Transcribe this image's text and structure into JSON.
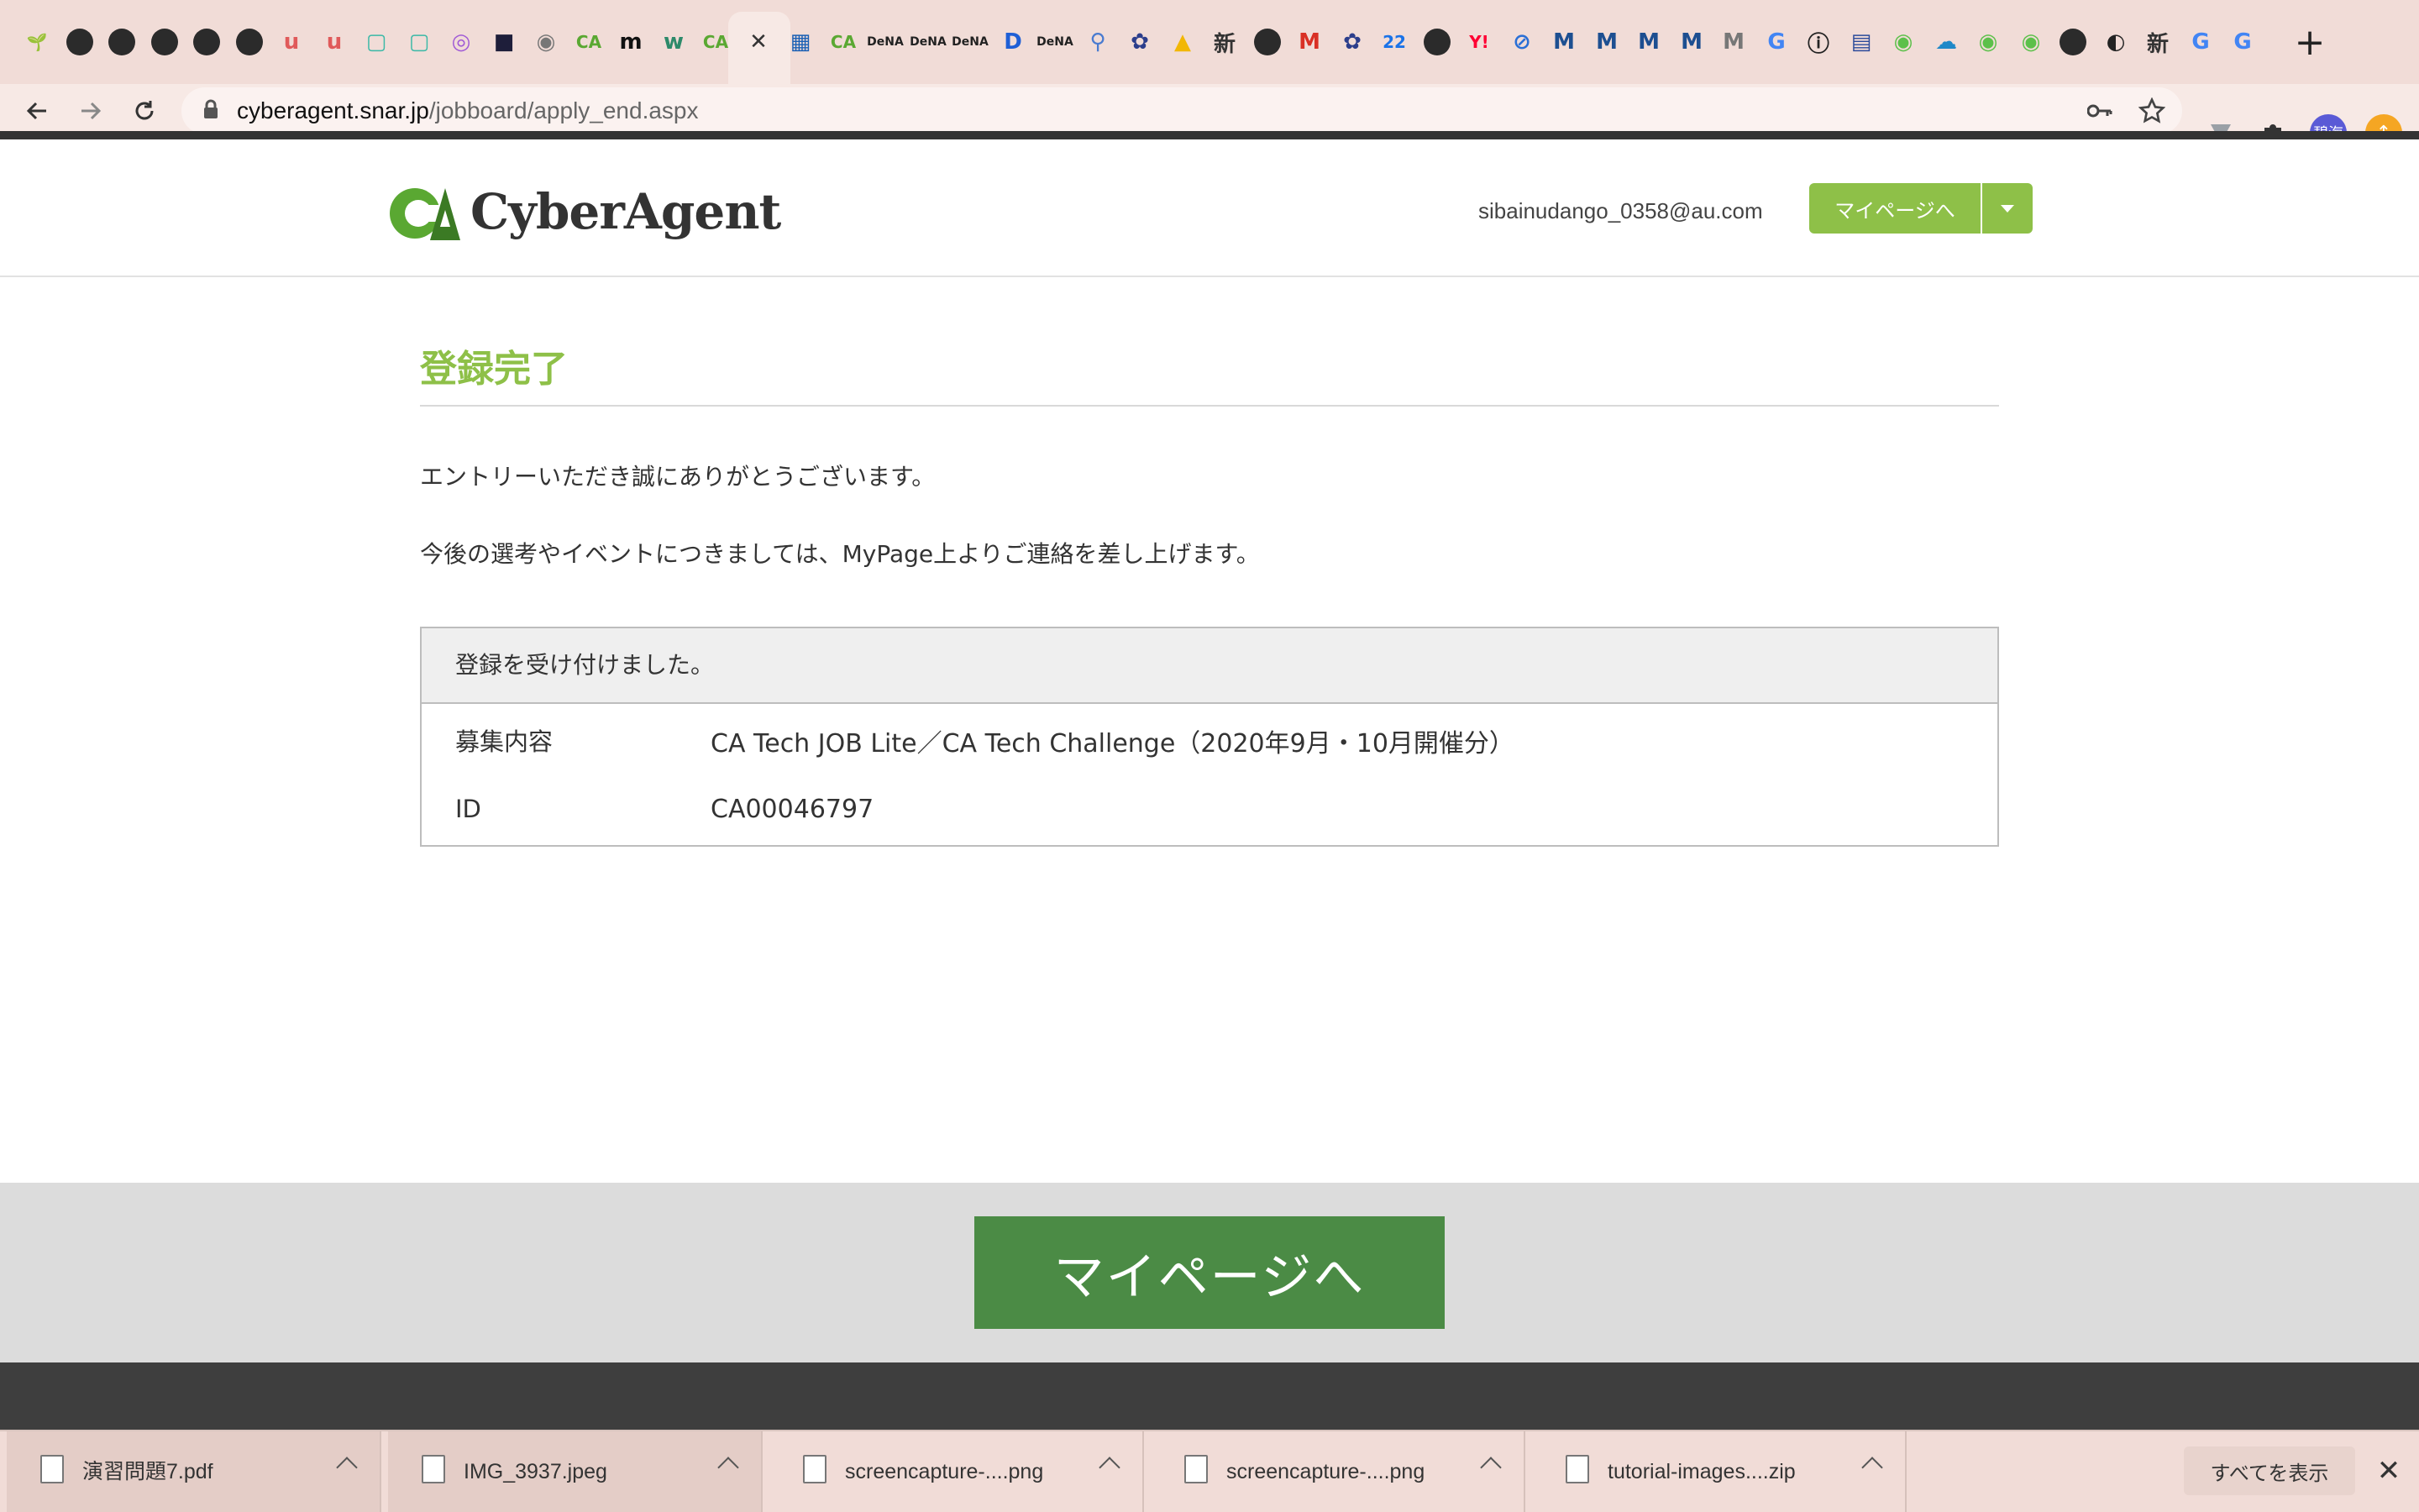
{
  "browser": {
    "tabs": [
      {
        "icon": "sprout-icon",
        "color": "#7ab648",
        "glyph": "🌱"
      },
      {
        "icon": "globe-icon",
        "color": "#2b2b2b",
        "glyph": ""
      },
      {
        "icon": "globe-icon",
        "color": "#2b2b2b",
        "glyph": ""
      },
      {
        "icon": "globe-icon",
        "color": "#2b2b2b",
        "glyph": ""
      },
      {
        "icon": "globe-icon",
        "color": "#2b2b2b",
        "glyph": ""
      },
      {
        "icon": "globe-icon",
        "color": "#2b2b2b",
        "glyph": ""
      },
      {
        "icon": "u-icon",
        "color": "#e05a5a",
        "glyph": "u"
      },
      {
        "icon": "u-icon",
        "color": "#e05a5a",
        "glyph": "u"
      },
      {
        "icon": "teal-square-icon",
        "color": "#3bb9a7",
        "glyph": "▢"
      },
      {
        "icon": "teal-square-icon",
        "color": "#3bb9a7",
        "glyph": "▢"
      },
      {
        "icon": "swirl-icon",
        "color": "#a05ad6",
        "glyph": "◎"
      },
      {
        "icon": "dark-square-icon",
        "color": "#1e1e3a",
        "glyph": "■"
      },
      {
        "icon": "circle-icon",
        "color": "#777777",
        "glyph": "◉"
      },
      {
        "icon": "ca-icon",
        "color": "#5aa832",
        "glyph": "CA"
      },
      {
        "icon": "m-icon",
        "color": "#111111",
        "glyph": "m"
      },
      {
        "icon": "w-icon",
        "color": "#2d8a6a",
        "glyph": "w"
      },
      {
        "icon": "ca-icon",
        "color": "#5aa832",
        "glyph": "CA"
      },
      {
        "icon": "close-icon",
        "color": "#333333",
        "glyph": "✕",
        "active": true
      },
      {
        "icon": "grid-icon",
        "color": "#1a5fb4",
        "glyph": "▦"
      },
      {
        "icon": "ca-icon",
        "color": "#5aa832",
        "glyph": "CA"
      },
      {
        "icon": "dena-icon",
        "color": "#222222",
        "glyph": "DeNA"
      },
      {
        "icon": "dena-icon",
        "color": "#222222",
        "glyph": "DeNA"
      },
      {
        "icon": "dena-icon",
        "color": "#222222",
        "glyph": "DeNA"
      },
      {
        "icon": "d-icon",
        "color": "#1f5fd6",
        "glyph": "D"
      },
      {
        "icon": "dena-icon",
        "color": "#222222",
        "glyph": "DeNA"
      },
      {
        "icon": "figure-icon",
        "color": "#4a7bd0",
        "glyph": "⚲"
      },
      {
        "icon": "flower-icon",
        "color": "#2c3e8c",
        "glyph": "✿"
      },
      {
        "icon": "drive-icon",
        "color": "#f2b705",
        "glyph": "▲"
      },
      {
        "icon": "kanji-icon",
        "color": "#333333",
        "glyph": "新"
      },
      {
        "icon": "globe-icon",
        "color": "#2b2b2b",
        "glyph": ""
      },
      {
        "icon": "gmail-icon",
        "color": "#d93025",
        "glyph": "M"
      },
      {
        "icon": "flower-icon",
        "color": "#2c3e8c",
        "glyph": "✿"
      },
      {
        "icon": "calendar-icon",
        "color": "#1a73e8",
        "glyph": "22"
      },
      {
        "icon": "globe-icon",
        "color": "#2b2b2b",
        "glyph": ""
      },
      {
        "icon": "yahoo-icon",
        "color": "#ff0033",
        "glyph": "Y!"
      },
      {
        "icon": "link-icon",
        "color": "#2a6fd6",
        "glyph": "⊘"
      },
      {
        "icon": "m-wave-icon",
        "color": "#1d4f91",
        "glyph": "M"
      },
      {
        "icon": "m-wave-icon",
        "color": "#1d4f91",
        "glyph": "M"
      },
      {
        "icon": "m-wave-icon",
        "color": "#1d4f91",
        "glyph": "M"
      },
      {
        "icon": "m-wave-icon",
        "color": "#1d4f91",
        "glyph": "M"
      },
      {
        "icon": "m-outline-icon",
        "color": "#777777",
        "glyph": "M"
      },
      {
        "icon": "google-icon",
        "color": "#4285f4",
        "glyph": "G"
      },
      {
        "icon": "info-icon",
        "color": "#222222",
        "glyph": "ⓘ"
      },
      {
        "icon": "layout-icon",
        "color": "#2b4a9a",
        "glyph": "▤"
      },
      {
        "icon": "green-circle-icon",
        "color": "#5cc04a",
        "glyph": "◉"
      },
      {
        "icon": "cloud-icon",
        "color": "#1e88c8",
        "glyph": "☁"
      },
      {
        "icon": "green-circle-icon",
        "color": "#5cc04a",
        "glyph": "◉"
      },
      {
        "icon": "green-circle-icon",
        "color": "#5cc04a",
        "glyph": "◉"
      },
      {
        "icon": "globe-icon",
        "color": "#2b2b2b",
        "glyph": ""
      },
      {
        "icon": "dog-icon",
        "color": "#222222",
        "glyph": "◐"
      },
      {
        "icon": "kanji-icon",
        "color": "#333333",
        "glyph": "新"
      },
      {
        "icon": "google-icon",
        "color": "#4285f4",
        "glyph": "G"
      },
      {
        "icon": "google-icon",
        "color": "#4285f4",
        "glyph": "G"
      }
    ],
    "new_tab": "+",
    "url_host": "cyberagent.snar.jp",
    "url_path": "/jobboard/apply_end.aspx",
    "profile_label": "碧海"
  },
  "header": {
    "logo_text": "CyberAgent",
    "email": "sibainudango_0358@au.com",
    "mypage_button": "マイページへ"
  },
  "main": {
    "title": "登録完了",
    "message_1": "エントリーいただき誠にありがとうございます。",
    "message_2": "今後の選考やイベントにつきましては、MyPage上よりご連絡を差し上げます。",
    "table_header": "登録を受け付けました。",
    "rows": [
      {
        "label": "募集内容",
        "value": "CA Tech JOB Lite／CA Tech Challenge（2020年9月・10月開催分）"
      },
      {
        "label": "ID",
        "value": "CA00046797"
      }
    ]
  },
  "footer": {
    "big_button": "マイページへ"
  },
  "downloads": {
    "items": [
      "演習問題7.pdf",
      "IMG_3937.jpeg",
      "screencapture-....png",
      "screencapture-....png",
      "tutorial-images....zip"
    ],
    "show_all": "すべてを表示"
  },
  "colors": {
    "accent": "#8ec048",
    "button_dark": "#4b8b45"
  }
}
